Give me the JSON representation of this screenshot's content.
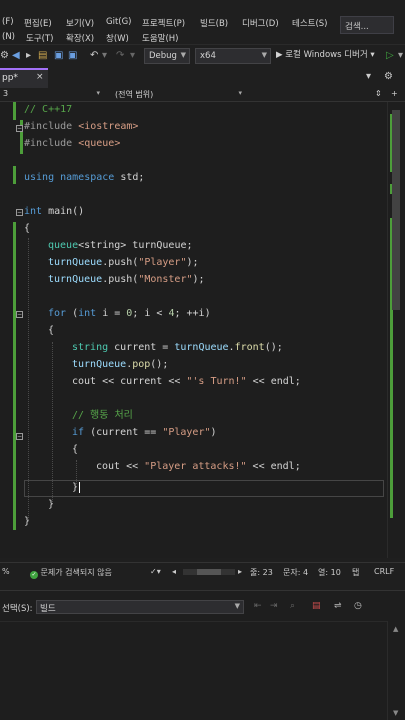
{
  "menu": {
    "row1": [
      "(F)",
      "편집(E)",
      "보기(V)",
      "Git(G)",
      "프로젝트(P)",
      "빌드(B)",
      "디버그(D)",
      "테스트(S)"
    ],
    "row2": [
      "(N)",
      "도구(T)",
      "확장(X)",
      "창(W)",
      "도움말(H)"
    ],
    "search": "검색..."
  },
  "toolbar": {
    "config": "Debug",
    "platform": "x64",
    "run_label": "▶ 로컬 Windows 디버거 ▾",
    "icons": [
      "settings-icon",
      "back-icon",
      "forward-icon",
      "new-file-icon",
      "open-icon",
      "save-icon",
      "save-all-icon",
      "undo-icon",
      "redo-icon",
      "run-icon",
      "run-no-debug-icon"
    ]
  },
  "tab": {
    "name": "pp*",
    "close": "×"
  },
  "navbar": {
    "project": "3",
    "scope": "(전역 범위)"
  },
  "code": {
    "l1_comment": "// C++17",
    "l2_pp": "#include",
    "l2_hdr": "<iostream>",
    "l3_pp": "#include",
    "l3_hdr": "<queue>",
    "l5_kw": "using namespace",
    "l5_rest": " std;",
    "l7_kw": "int",
    "l7_rest": " main()",
    "l8": "{",
    "l9_ty": "queue",
    "l9_rest": "<string> turnQueue;",
    "l10_a": "turnQueue",
    "l10_b": ".push(",
    "l10_s": "\"Player\"",
    "l10_c": ");",
    "l11_a": "turnQueue",
    "l11_b": ".push(",
    "l11_s": "\"Monster\"",
    "l11_c": ");",
    "l13_kw": "for",
    "l13_a": " (",
    "l13_kw2": "int",
    "l13_b": " i = ",
    "l13_n0": "0",
    "l13_c": "; i < ",
    "l13_n4": "4",
    "l13_d": "; ++i)",
    "l14": "{",
    "l15_ty": "string",
    "l15_a": " current = ",
    "l15_b": "turnQueue",
    "l15_c": ".",
    "l15_fn": "front",
    "l15_d": "();",
    "l16_a": "turnQueue",
    "l16_b": ".",
    "l16_fn": "pop",
    "l16_c": "();",
    "l17_a": "cout << current << ",
    "l17_s": "\"'s Turn!\"",
    "l17_b": " << endl;",
    "l19_cm": "// 행동 처리",
    "l20_kw": "if",
    "l20_a": " (current == ",
    "l20_s": "\"Player\"",
    "l20_b": ")",
    "l21": "{",
    "l22_a": "cout << ",
    "l22_s": "\"Player attacks!\"",
    "l22_b": " << endl;",
    "l23": "}",
    "l24": "}",
    "l25": "}"
  },
  "status": {
    "zoom": "%",
    "issues": "문제가 검색되지 않음",
    "line": "줄: 23",
    "col": "문자: 4",
    "column": "열: 10",
    "tab": "탭",
    "eol": "CRLF"
  },
  "output": {
    "label": "선택(S):",
    "source": "빌드"
  },
  "colors": {
    "accent": "#a371f7",
    "change_bar": "#4d9e3a",
    "editor_bg": "#1e1e1e"
  }
}
